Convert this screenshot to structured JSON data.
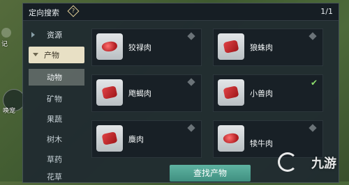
{
  "header": {
    "title": "定向搜索",
    "help_icon": "?",
    "page": "1/1"
  },
  "hud": {
    "label_top": "记",
    "label_btn": "唤宠"
  },
  "sidebar": {
    "section": "资源",
    "items": [
      {
        "label": "产物",
        "state": "expanded"
      },
      {
        "label": "动物",
        "state": "selected"
      },
      {
        "label": "矿物"
      },
      {
        "label": "果蔬"
      },
      {
        "label": "树木"
      },
      {
        "label": "草药"
      },
      {
        "label": "花草"
      }
    ]
  },
  "products": [
    {
      "name": "狡禄肉",
      "icon": "meat-icon",
      "marker": "diamond"
    },
    {
      "name": "狼蛛肉",
      "icon": "meat-icon",
      "marker": "diamond"
    },
    {
      "name": "飑蝎肉",
      "icon": "meat-icon",
      "marker": "diamond"
    },
    {
      "name": "小兽肉",
      "icon": "meat-icon",
      "marker": "check"
    },
    {
      "name": "麋肉",
      "icon": "meat-icon",
      "marker": "diamond"
    },
    {
      "name": "犊牛肉",
      "icon": "meat-icon",
      "marker": "diamond"
    }
  ],
  "footer": {
    "find_label": "查找产物"
  },
  "watermark": {
    "text": "九游"
  }
}
